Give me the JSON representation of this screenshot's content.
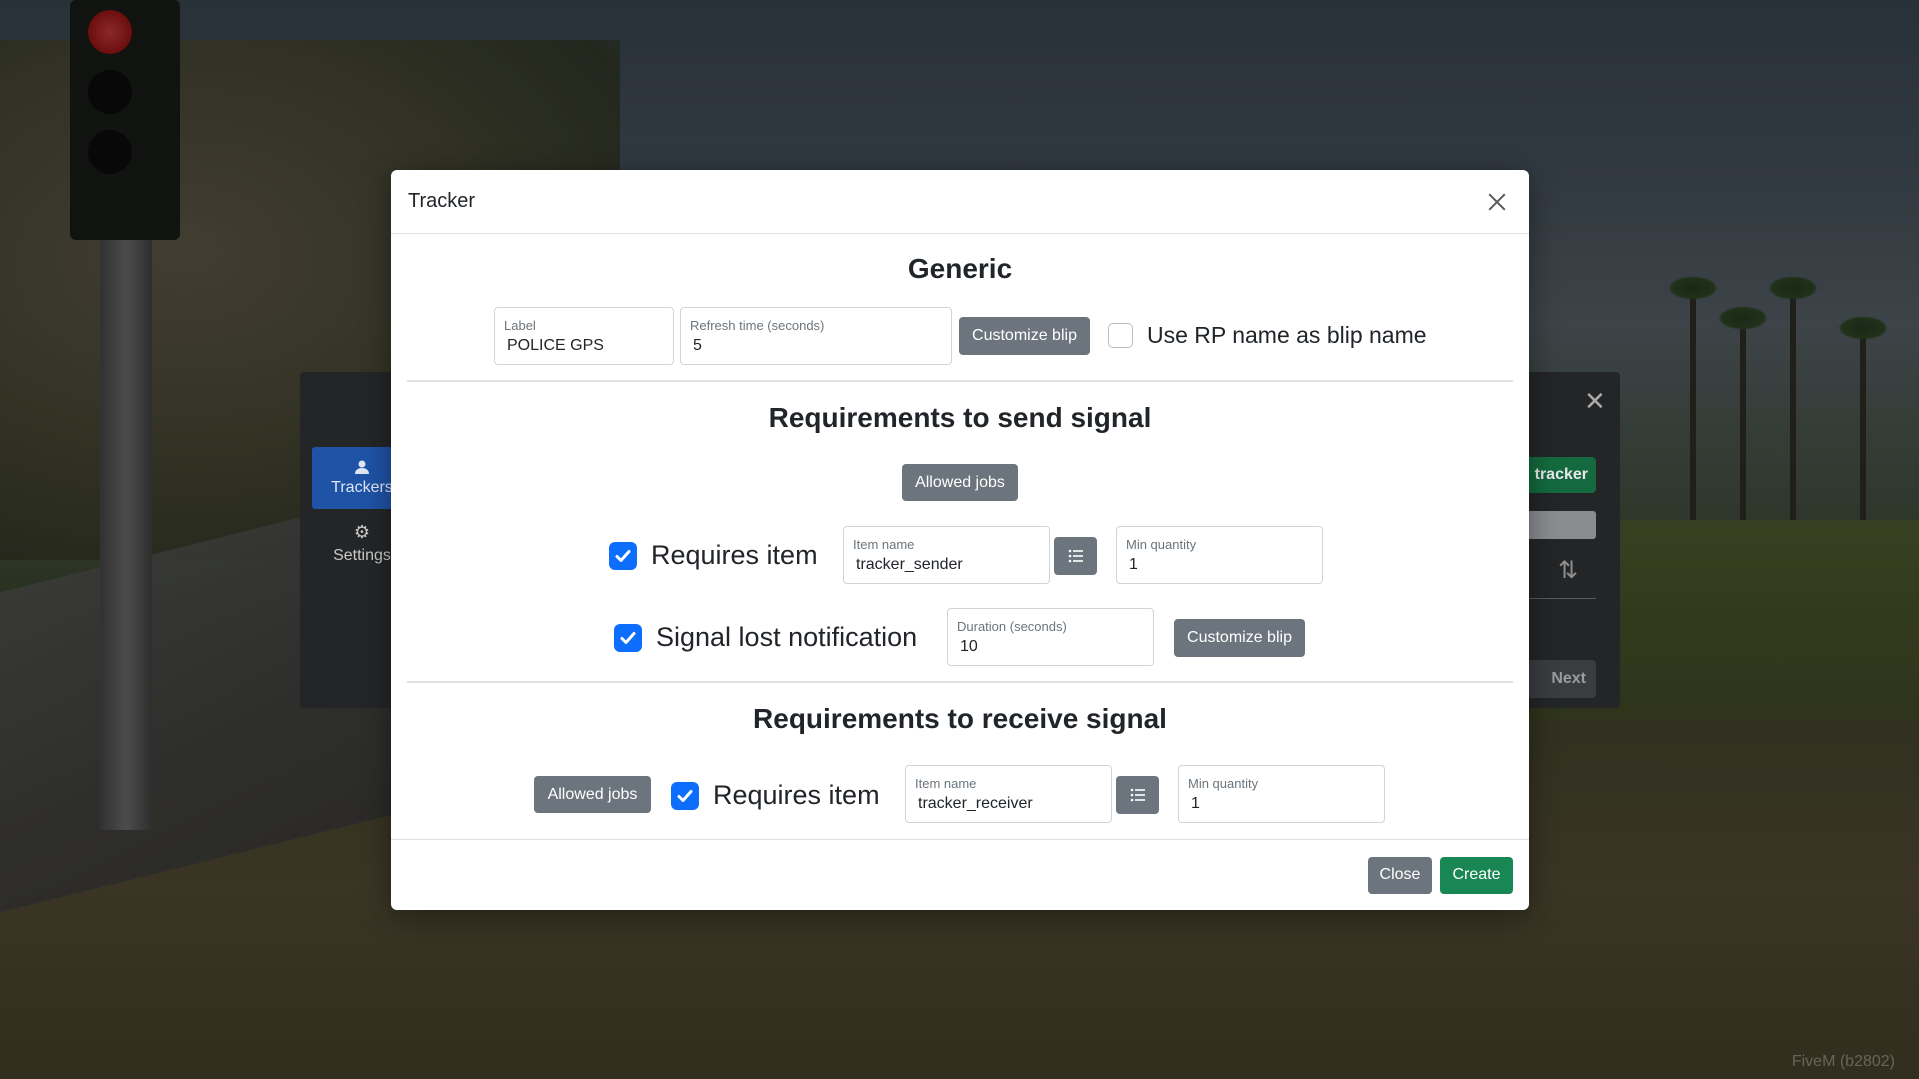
{
  "modal": {
    "title": "Tracker",
    "generic": {
      "heading": "Generic",
      "label_field": {
        "label": "Label",
        "value": "POLICE GPS"
      },
      "refresh_field": {
        "label": "Refresh time (seconds)",
        "value": "5"
      },
      "customize_blip_label": "Customize blip",
      "use_rp_name": {
        "label": "Use RP name as blip name",
        "checked": false
      }
    },
    "send": {
      "heading": "Requirements to send signal",
      "allowed_jobs_label": "Allowed jobs",
      "requires_item": {
        "label": "Requires item",
        "checked": true
      },
      "item_name": {
        "label": "Item name",
        "value": "tracker_sender"
      },
      "min_quantity": {
        "label": "Min quantity",
        "value": "1"
      },
      "signal_lost": {
        "label": "Signal lost notification",
        "checked": true
      },
      "duration": {
        "label": "Duration (seconds)",
        "value": "10"
      },
      "customize_blip_label": "Customize blip"
    },
    "receive": {
      "heading": "Requirements to receive signal",
      "allowed_jobs_label": "Allowed jobs",
      "requires_item": {
        "label": "Requires item",
        "checked": true
      },
      "item_name": {
        "label": "Item name",
        "value": "tracker_receiver"
      },
      "min_quantity": {
        "label": "Min quantity",
        "value": "1"
      }
    },
    "footer": {
      "close_label": "Close",
      "create_label": "Create"
    }
  },
  "background_app": {
    "sidebar": [
      {
        "label": "Trackers",
        "icon": "user-icon",
        "active": true
      },
      {
        "label": "Settings",
        "icon": "gear-icon",
        "active": false
      }
    ],
    "tracker_button_label": "tracker",
    "next_label": "Next"
  },
  "watermark": "FiveM (b2802)",
  "colors": {
    "primary": "#0d6efd",
    "secondary": "#6c757d",
    "success": "#198754",
    "sidebar_active": "#1f53a6"
  }
}
